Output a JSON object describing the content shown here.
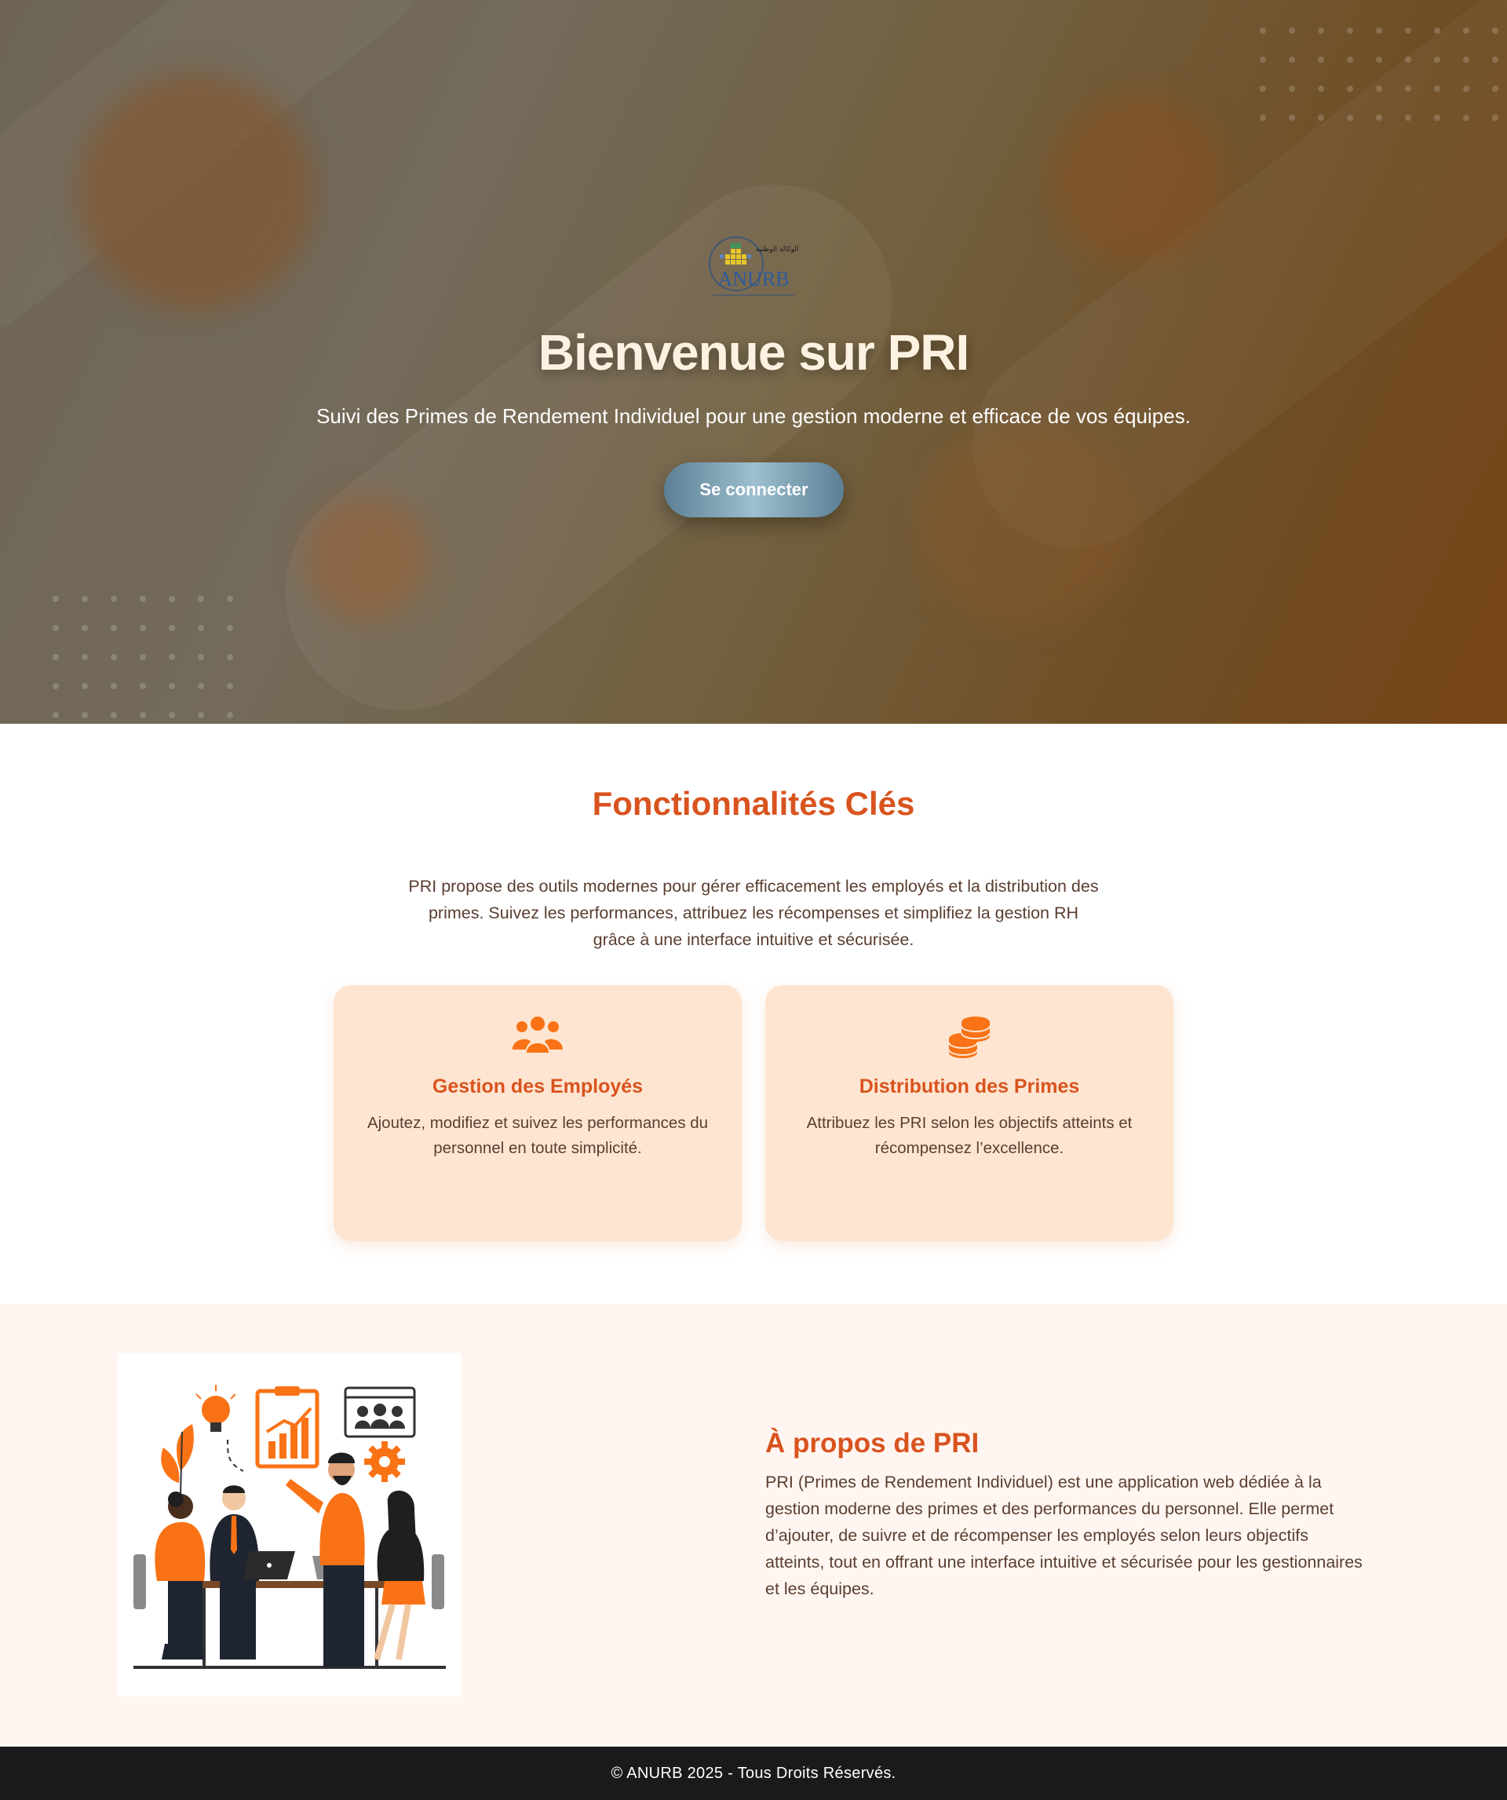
{
  "hero": {
    "logo_text": "ANURB",
    "logo_arabic": "الوكالة الوطنية",
    "title": "Bienvenue sur PRI",
    "subtitle": "Suivi des Primes de Rendement Individuel pour une gestion moderne et efficace de vos équipes.",
    "login_label": "Se connecter"
  },
  "features": {
    "title": "Fonctionnalités Clés",
    "description": "PRI propose des outils modernes pour gérer efficacement les employés et la distribution des primes. Suivez les performances, attribuez les récompenses et simplifiez la gestion RH grâce à une interface intuitive et sécurisée.",
    "cards": [
      {
        "icon": "users-icon",
        "title": "Gestion des Employés",
        "text": "Ajoutez, modifiez et suivez les performances du personnel en toute simplicité."
      },
      {
        "icon": "coins-icon",
        "title": "Distribution des Primes",
        "text": "Attribuez les PRI selon les objectifs atteints et récompensez l’excellence."
      }
    ]
  },
  "about": {
    "title": "À propos de PRI",
    "text": "PRI (Primes de Rendement Individuel) est une application web dédiée à la gestion moderne des primes et des performances du personnel. Elle permet d’ajouter, de suivre et de récompenser les employés selon leurs objectifs atteints, tout en offrant une interface intuitive et sécurisée pour les gestionnaires et les équipes."
  },
  "footer": {
    "copyright": "© ANURB 2025 - Tous Droits Réservés."
  },
  "colors": {
    "accent": "#d9531e",
    "icon_orange": "#f97316",
    "card_bg": "#fee5d1",
    "about_bg": "#fff6f1",
    "footer_bg": "#1a1a1a"
  }
}
